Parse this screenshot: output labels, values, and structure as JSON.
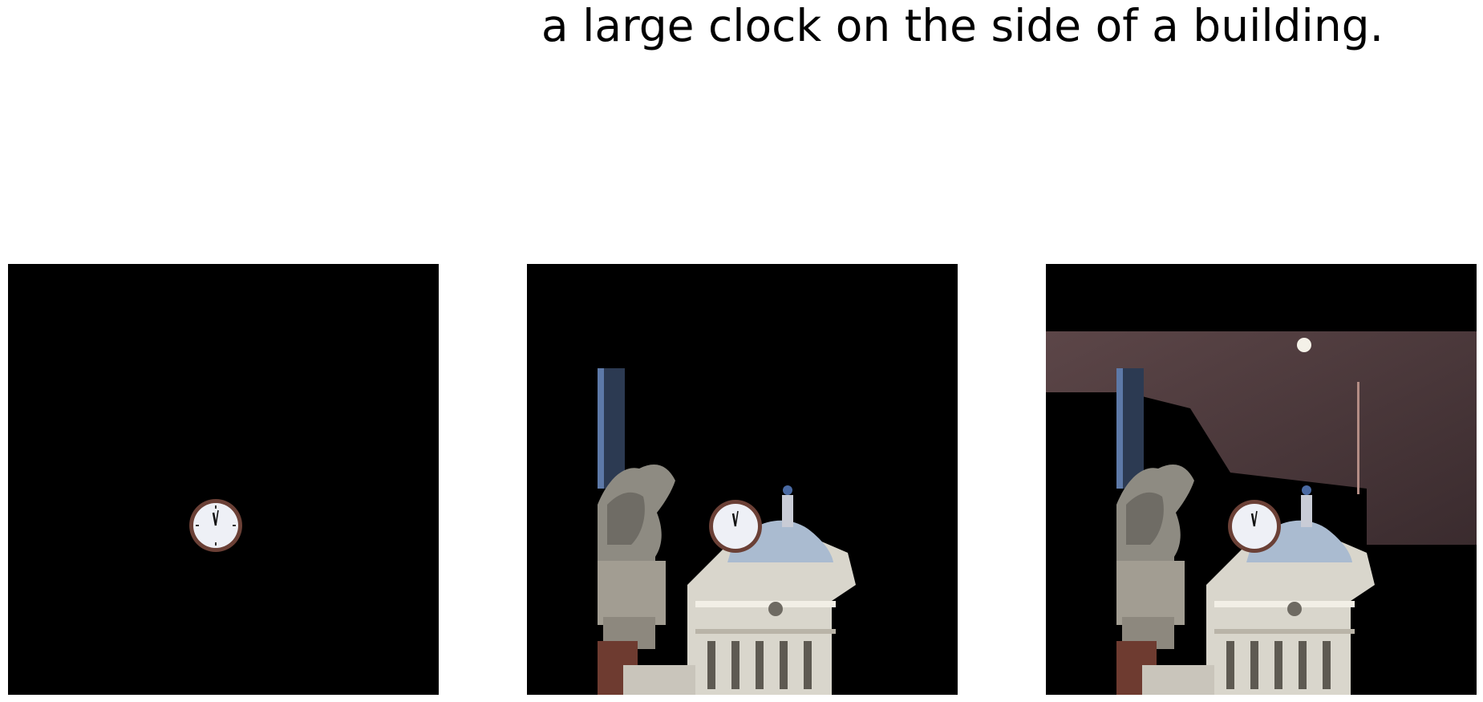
{
  "caption": "a large clock on the side of a building.",
  "panels": [
    {
      "id": "panel-1"
    },
    {
      "id": "panel-2"
    },
    {
      "id": "panel-3"
    }
  ]
}
